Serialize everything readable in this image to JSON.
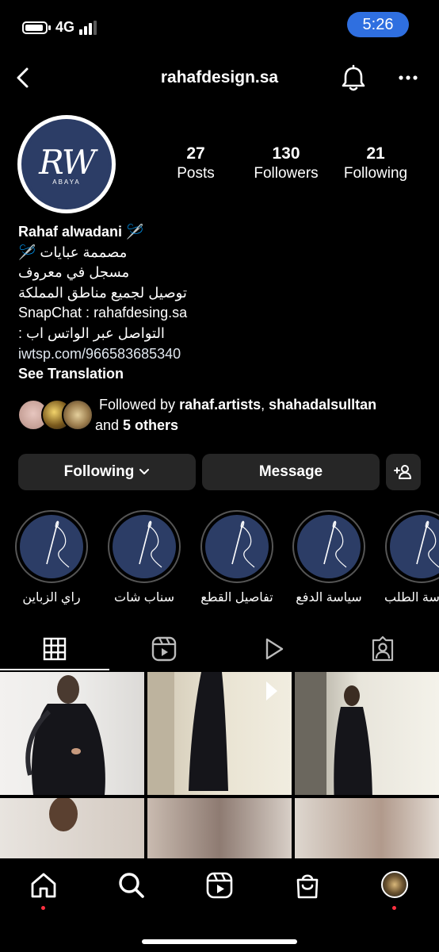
{
  "status_bar": {
    "network": "4G",
    "time": "5:26"
  },
  "header": {
    "username": "rahafdesign.sa"
  },
  "profile": {
    "avatar_monogram": "RW",
    "avatar_subtext": "ABAYA",
    "stats": [
      {
        "value": "27",
        "label": "Posts"
      },
      {
        "value": "130",
        "label": "Followers"
      },
      {
        "value": "21",
        "label": "Following"
      }
    ],
    "name": "Rahaf alwadani 🪡",
    "bio_lines": [
      "مصممة عبايات 🪡",
      "مسجل في معروف",
      "توصيل لجميع مناطق المملكة",
      "SnapChat : rahafdesing.sa",
      "التواصل عبر الواتس اب :"
    ],
    "link": "iwtsp.com/966583685340",
    "see_translation": "See Translation"
  },
  "followed_by": {
    "prefix": "Followed by ",
    "user1": "rahaf.artists",
    "sep": ", ",
    "user2": "shahadalsulltan",
    "and": " and ",
    "others": "5 others"
  },
  "actions": {
    "following_label": "Following",
    "message_label": "Message"
  },
  "highlights": [
    {
      "label": "راي الزباين"
    },
    {
      "label": "سناب شات"
    },
    {
      "label": "تفاصيل القطع"
    },
    {
      "label": "سياسة الدفع"
    },
    {
      "label": "سياسة الطلب"
    }
  ],
  "colors": {
    "background": "#000000",
    "button_bg": "#262626",
    "time_pill": "#2f6fe0",
    "highlight_navy": "#2c3d66",
    "notification_dot": "#ff3040"
  }
}
